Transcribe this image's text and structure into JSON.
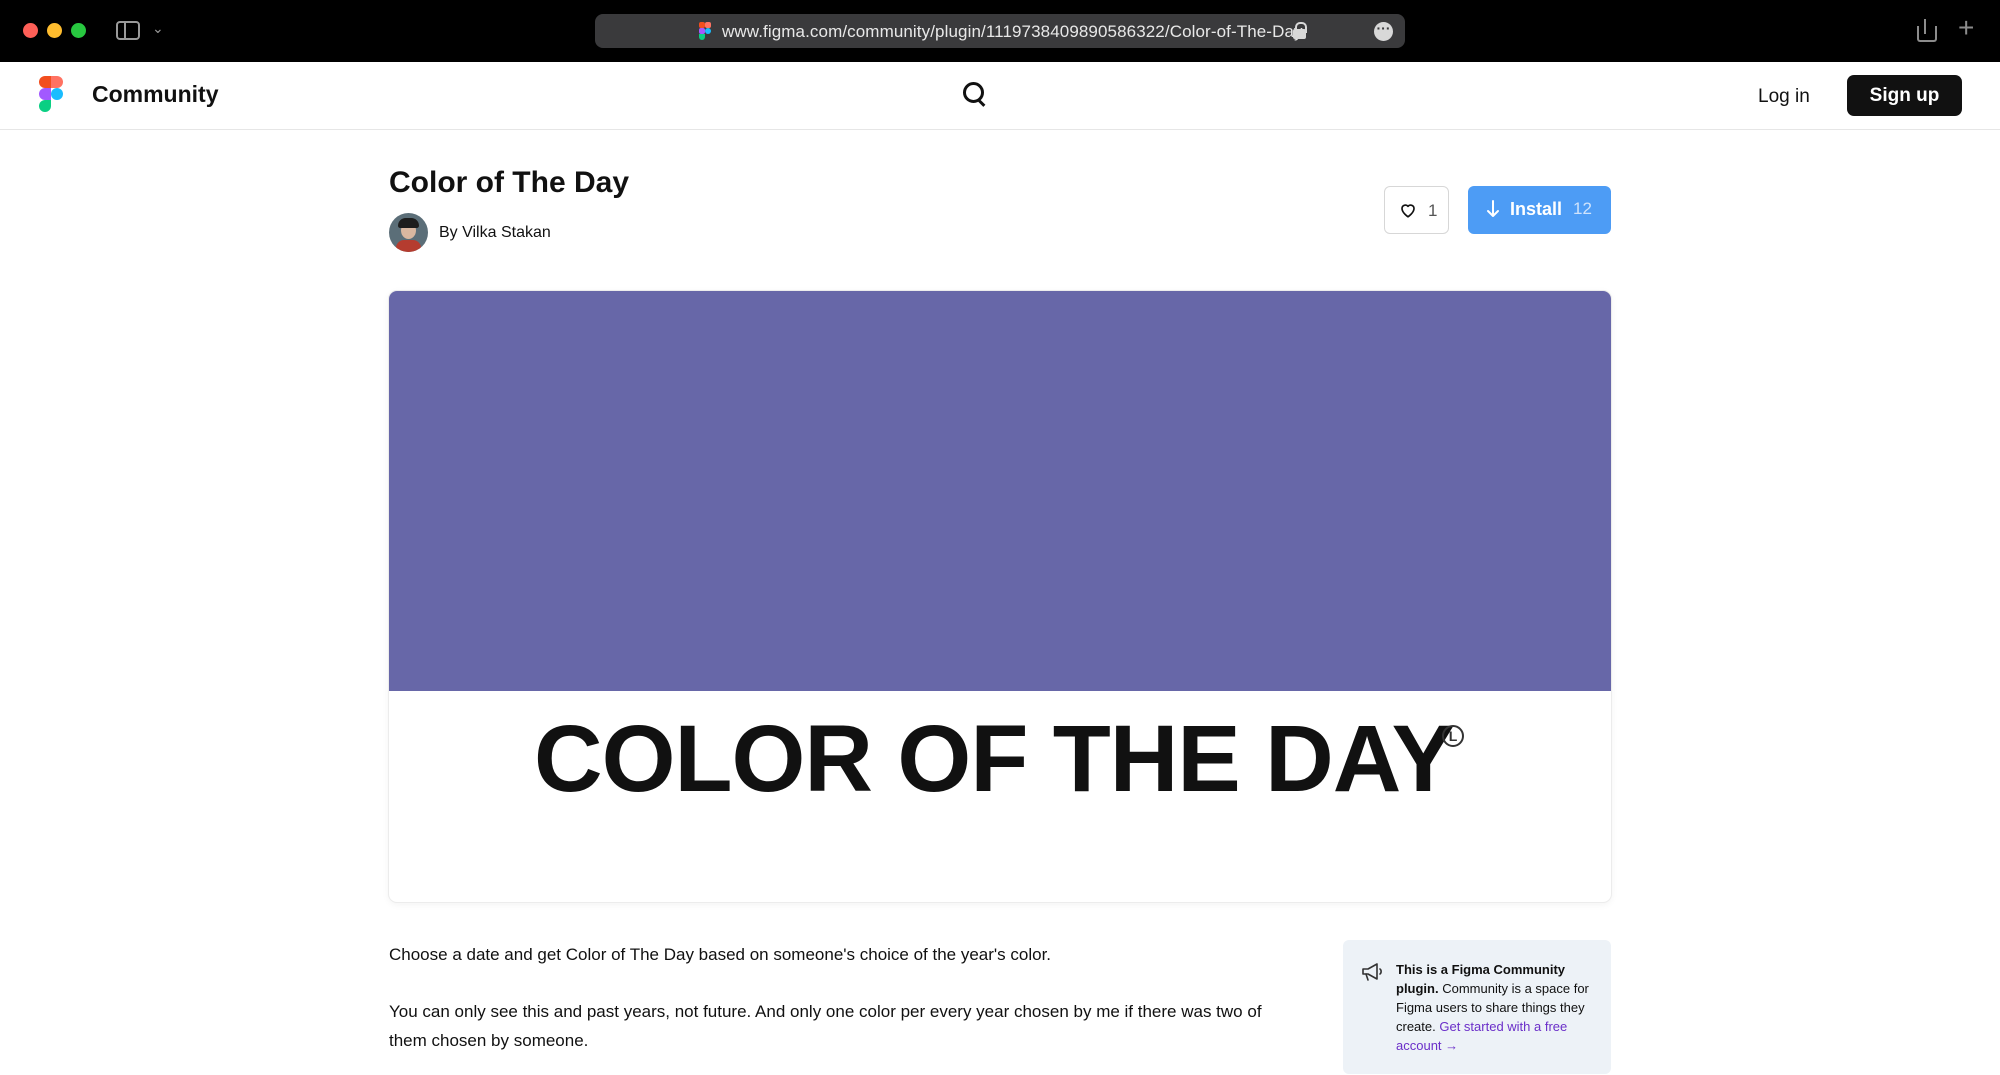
{
  "browser": {
    "url": "www.figma.com/community/plugin/1119738409890586322/Color-of-The-Day"
  },
  "header": {
    "brand": "Community",
    "login_label": "Log in",
    "signup_label": "Sign up"
  },
  "plugin": {
    "title": "Color of The Day",
    "byline": "By Vilka Stakan",
    "like_count": "1",
    "install_label": "Install",
    "install_count": "12",
    "cover": {
      "wordmark": "COLOR OF THE DAY",
      "mark": "L",
      "swatch_color": "#6767a8"
    },
    "description": [
      "Choose a date and get Color of The Day based on someone's choice of the year's color.",
      "You can only see this and past years, not future. And only one color per every year chosen by me if there was two of them chosen by someone."
    ]
  },
  "info_card": {
    "bold": "This is a Figma Community plugin.",
    "text": " Community is a space for Figma users to share things they create. ",
    "link": "Get started with a free account →"
  },
  "colors": {
    "accent_blue": "#4d9cf5",
    "brand_black": "#111111",
    "link_purple": "#6b2fc9"
  }
}
